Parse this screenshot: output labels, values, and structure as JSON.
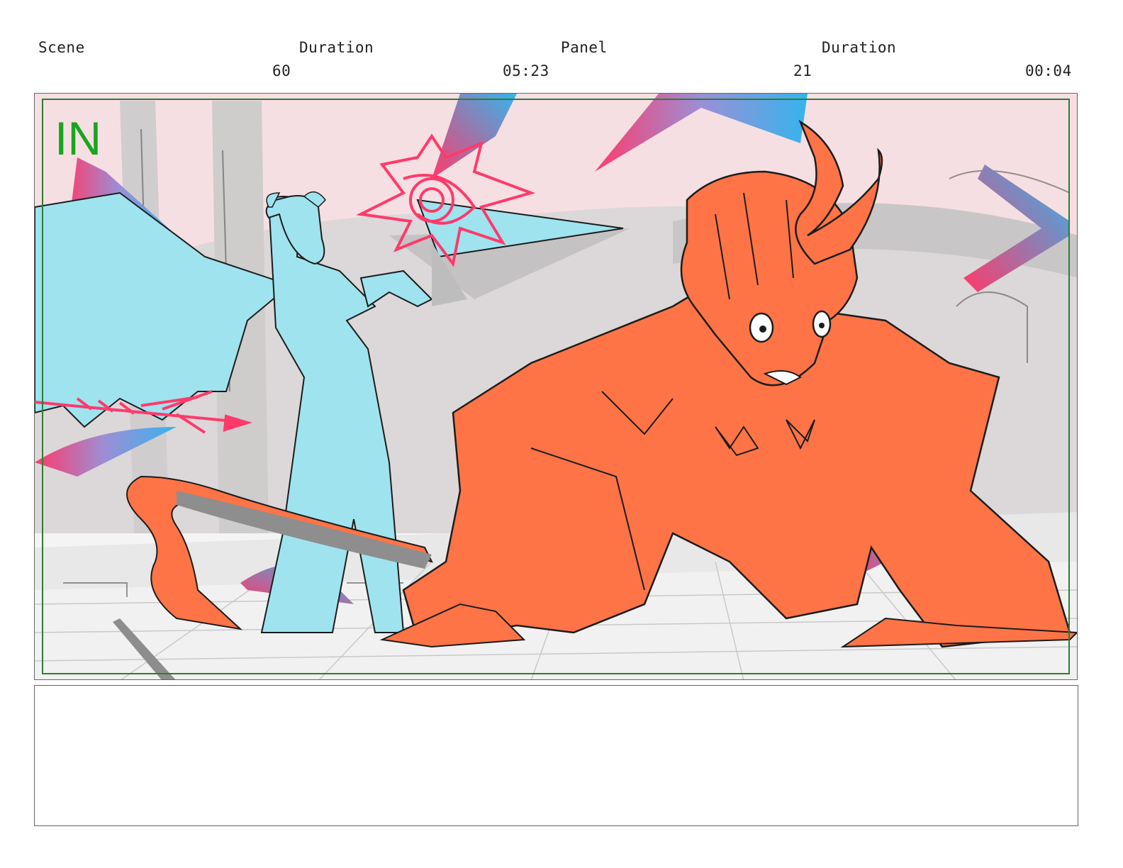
{
  "header": {
    "scene_label": "Scene",
    "duration_label_1": "Duration",
    "panel_label": "Panel",
    "duration_label_2": "Duration",
    "scene_value": "60",
    "scene_duration_value": "05:23",
    "panel_value": "21",
    "panel_duration_value": "00:04"
  },
  "panel": {
    "in_marker": "IN",
    "safe_frame_color": "#2e7d32",
    "sky_color": "#f6dfe2",
    "cyan_character_color": "#9fe3ef",
    "orange_character_color": "#ff7446",
    "effect_star_color": "#ff3a6b",
    "icons": [
      "winged-demon-sketch",
      "crawling-demon-girl-sketch",
      "magic-burst",
      "trident"
    ]
  },
  "notes": {
    "text": ""
  }
}
